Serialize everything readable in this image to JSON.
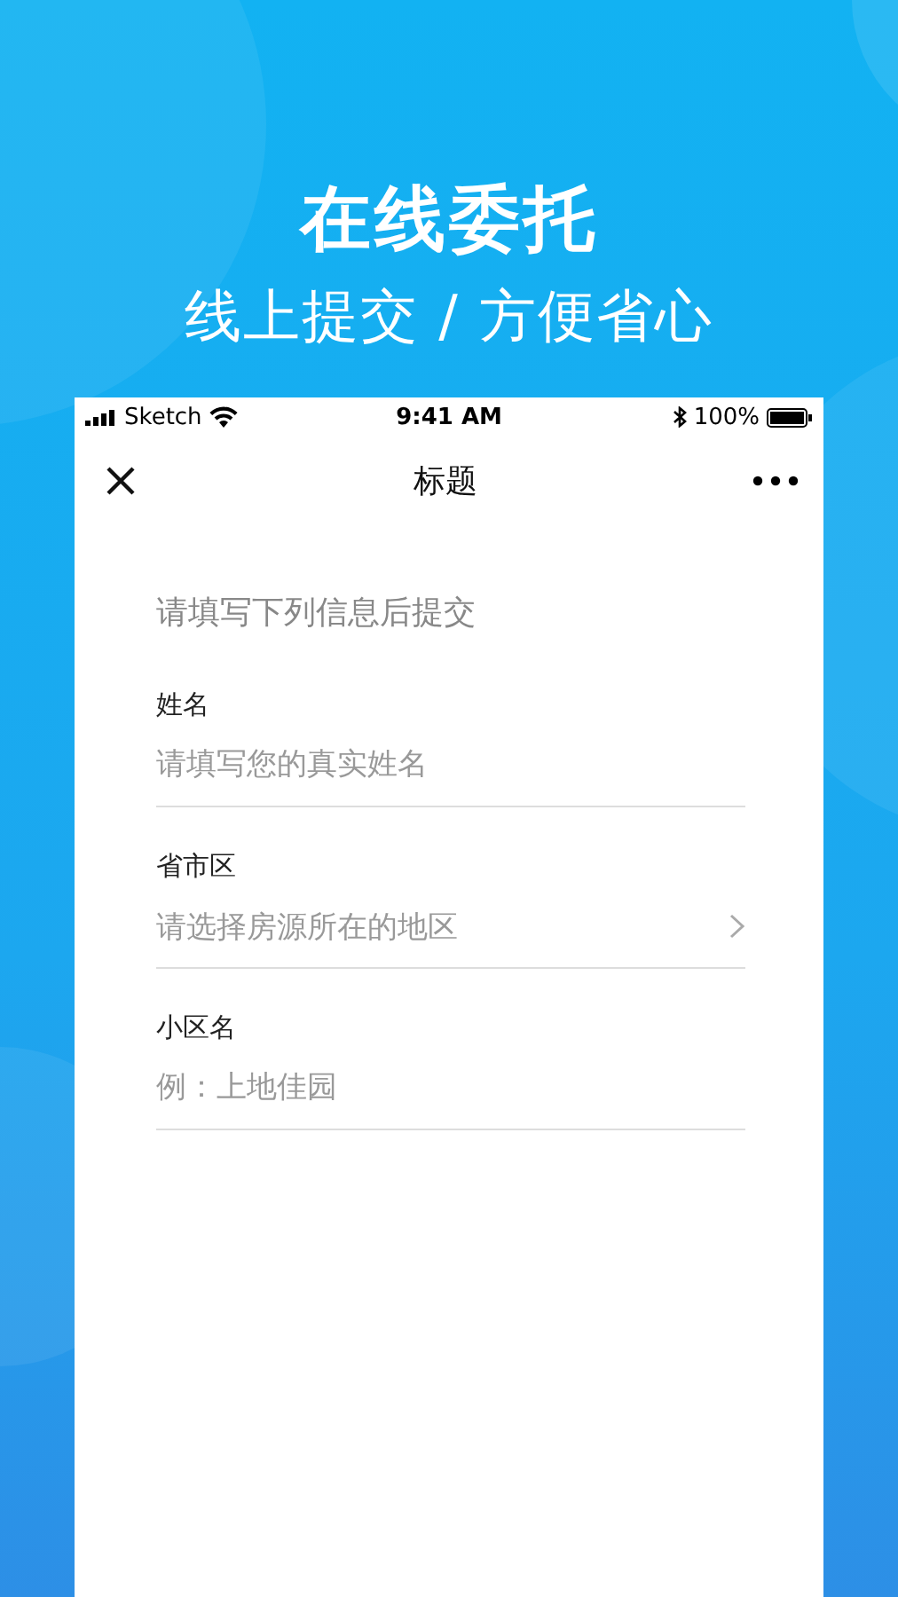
{
  "hero": {
    "title": "在线委托",
    "subtitle": "线上提交 / 方便省心"
  },
  "status_bar": {
    "carrier": "Sketch",
    "time": "9:41 AM",
    "battery": "100%"
  },
  "nav_bar": {
    "title": "标题"
  },
  "form": {
    "intro": "请填写下列信息后提交",
    "fields": [
      {
        "kind": "input",
        "label": "姓名",
        "placeholder": "请填写您的真实姓名"
      },
      {
        "kind": "select",
        "label": "省市区",
        "placeholder": "请选择房源所在的地区"
      },
      {
        "kind": "input",
        "label": "小区名",
        "placeholder": "例：上地佳园"
      }
    ]
  }
}
